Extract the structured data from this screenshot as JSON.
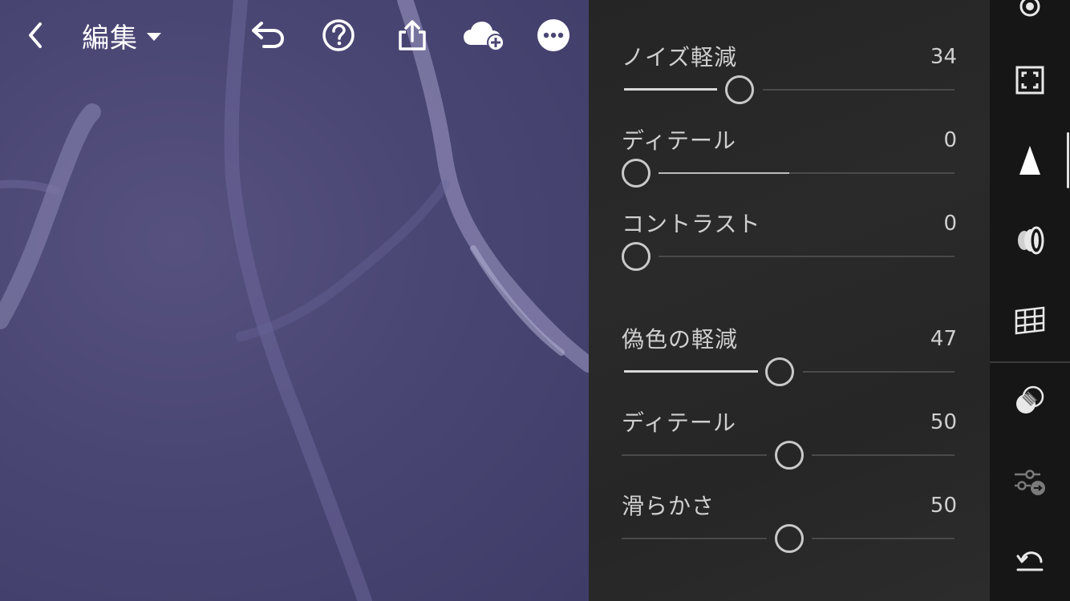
{
  "header": {
    "mode_label": "編集",
    "icons": [
      "back-icon",
      "caret-down-icon",
      "undo-icon",
      "help-icon",
      "share-icon",
      "cloud-add-icon",
      "more-icon"
    ]
  },
  "colors": {
    "photo_bg": "#4a4674",
    "panel_bg": "#272727",
    "rail_bg": "#161616",
    "text": "#cfcfcf",
    "track_fill": "#d8d8d8",
    "track_bg": "#4a4a4a"
  },
  "noise": {
    "luminance": {
      "label": "ノイズ軽減",
      "value": "34"
    },
    "detail": {
      "label": "ディテール",
      "value": "0"
    },
    "contrast": {
      "label": "コントラスト",
      "value": "0"
    }
  },
  "color_noise": {
    "reduction": {
      "label": "偽色の軽減",
      "value": "47"
    },
    "detail": {
      "label": "ディテール",
      "value": "50"
    },
    "smoothness": {
      "label": "滑らかさ",
      "value": "50"
    }
  },
  "rail": {
    "icons": [
      "healing-icon",
      "crop-icon",
      "detail-icon",
      "optics-icon",
      "geometry-icon",
      "selective-icon",
      "presets-icon",
      "reset-icon"
    ],
    "active": "detail-icon"
  }
}
